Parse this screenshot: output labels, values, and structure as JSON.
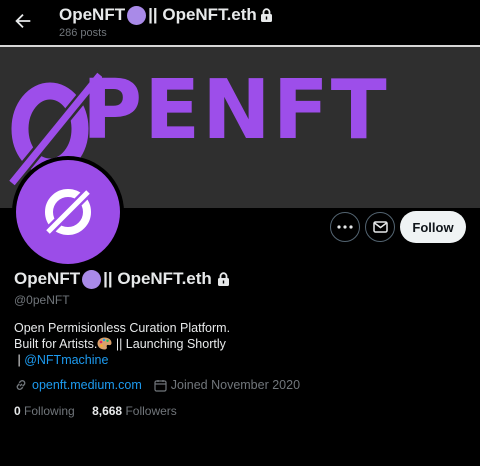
{
  "header": {
    "title_prefix": "OpeNFT",
    "title_suffix": " || OpeNFT.eth",
    "post_count": "286 posts"
  },
  "banner": {
    "text": "PENFT"
  },
  "actions": {
    "follow_label": "Follow"
  },
  "profile": {
    "name_prefix": "OpeNFT",
    "name_suffix": " || OpeNFT.eth",
    "handle": "@0peNFT",
    "bio_line1": "Open Permisionless Curation Platform.",
    "bio_line2": "Built for Artists.",
    "bio_line2_after": " || Launching Shortly",
    "bio_line3_prefix": " | ",
    "bio_mention": "@NFTmachine",
    "website": "openft.medium.com",
    "joined": "Joined November 2020",
    "following_count": "0",
    "following_label": "Following",
    "followers_count": "8,668",
    "followers_label": "Followers"
  },
  "colors": {
    "brand_purple": "#9d4eea",
    "link_blue": "#1d9bf0",
    "muted_text": "#71767b"
  }
}
